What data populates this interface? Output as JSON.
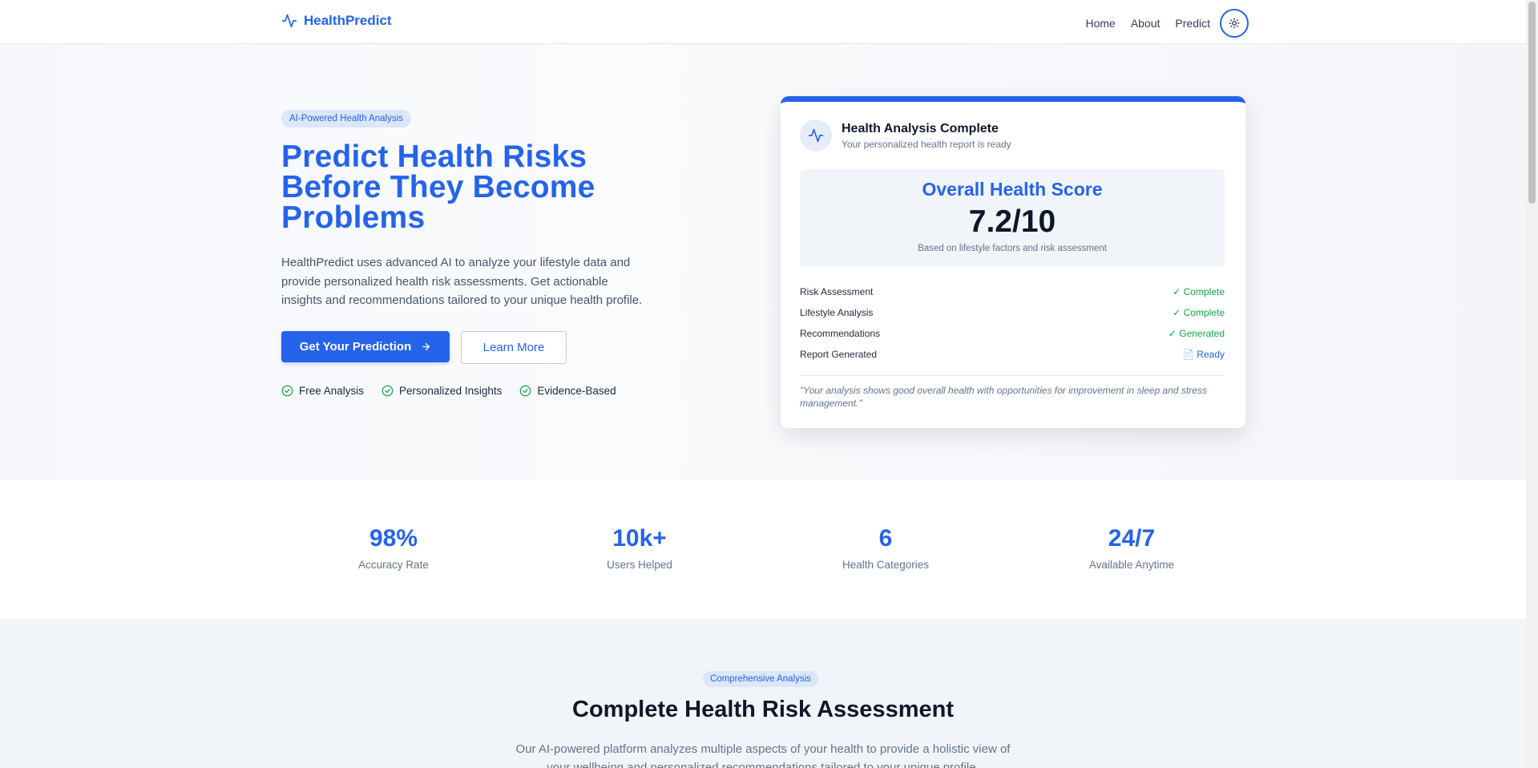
{
  "nav": {
    "brand": "HealthPredict",
    "links": [
      "Home",
      "About",
      "Predict"
    ]
  },
  "hero": {
    "badge": "AI-Powered Health Analysis",
    "title": "Predict Health Risks Before They Become Problems",
    "description": "HealthPredict uses advanced AI to analyze your lifestyle data and provide personalized health risk assessments. Get actionable insights and recommendations tailored to your unique health profile.",
    "primary_cta": "Get Your Prediction",
    "secondary_cta": "Learn More",
    "features": [
      "Free Analysis",
      "Personalized Insights",
      "Evidence-Based"
    ]
  },
  "card": {
    "title": "Health Analysis Complete",
    "subtitle": "Your personalized health report is ready",
    "score_label": "Overall Health Score",
    "score_value": "7.2/10",
    "score_note": "Based on lifestyle factors and risk assessment",
    "status": [
      {
        "name": "Risk Assessment",
        "value": "✓ Complete"
      },
      {
        "name": "Lifestyle Analysis",
        "value": "✓ Complete"
      },
      {
        "name": "Recommendations",
        "value": "✓ Generated"
      },
      {
        "name": "Report Generated",
        "value": "📄 Ready"
      }
    ],
    "quote": "\"Your analysis shows good overall health with opportunities for improvement in sleep and stress management.\""
  },
  "stats": [
    {
      "value": "98%",
      "label": "Accuracy Rate"
    },
    {
      "value": "10k+",
      "label": "Users Helped"
    },
    {
      "value": "6",
      "label": "Health Categories"
    },
    {
      "value": "24/7",
      "label": "Available Anytime"
    }
  ],
  "analysis": {
    "badge": "Comprehensive Analysis",
    "title": "Complete Health Risk Assessment",
    "description": "Our AI-powered platform analyzes multiple aspects of your health to provide a holistic view of your wellbeing and personalized recommendations tailored to your unique profile."
  },
  "colors": {
    "primary": "#2563eb",
    "success": "#16a34a",
    "text": "#0f172a",
    "muted": "#64748b"
  },
  "icons": [
    "activity-icon",
    "sun-icon",
    "arrow-right-icon",
    "check-circle-icon",
    "document-icon"
  ]
}
